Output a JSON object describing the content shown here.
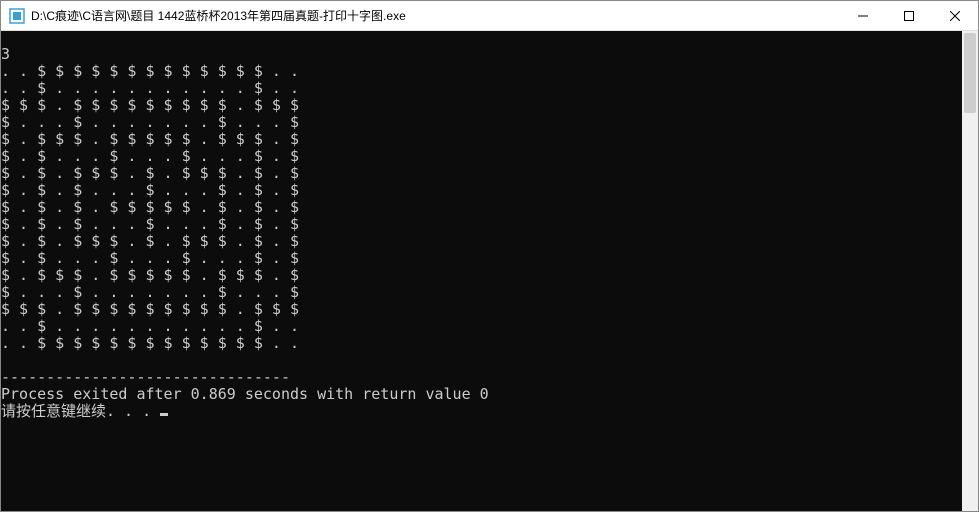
{
  "window": {
    "title": "D:\\C痕迹\\C语言网\\题目 1442蓝桥杯2013年第四届真题-打印十字图.exe"
  },
  "console": {
    "lines": [
      "3",
      "..$$$$$$$$$$$$$..",
      "..$...........$..",
      "$$$.$$$$$$$$$.$$$",
      "$...$.......$...$",
      "$.$$$.$$$$$.$$$.$",
      "$.$...$...$...$.$",
      "$.$.$$$.$.$$$.$.$",
      "$.$.$...$...$.$.$",
      "$.$.$.$$$$$.$.$.$",
      "$.$.$...$...$.$.$",
      "$.$.$$$.$.$$$.$.$",
      "$.$...$...$...$.$",
      "$.$$$.$$$$$.$$$.$",
      "$...$.......$...$",
      "$$$.$$$$$$$$$.$$$",
      "..$...........$..",
      "..$$$$$$$$$$$$$..",
      "",
      "--------------------------------",
      "Process exited after 0.869 seconds with return value 0",
      "请按任意键继续. . . "
    ]
  },
  "process": {
    "elapsed_seconds": 0.869,
    "return_value": 0
  }
}
